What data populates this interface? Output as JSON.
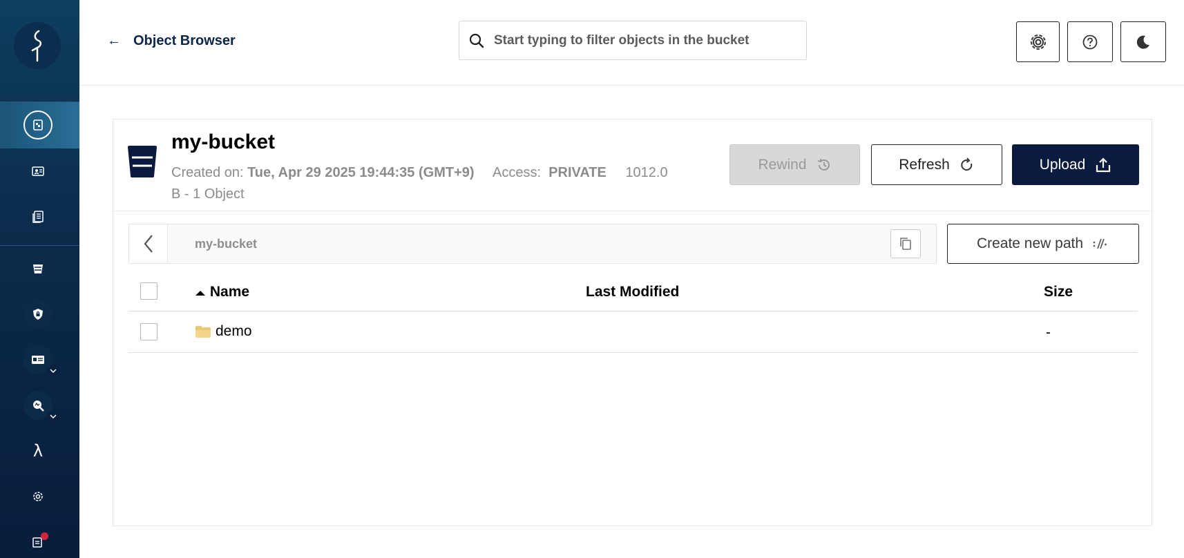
{
  "header": {
    "back_label": "Object Browser",
    "search_placeholder": "Start typing to filter objects in the bucket"
  },
  "bucket": {
    "name": "my-bucket",
    "created_label": "Created on:",
    "created_value": "Tue, Apr 29 2025 19:44:35 (GMT+9)",
    "access_label": "Access:",
    "access_value": "PRIVATE",
    "size_summary_1": "1012.0",
    "size_summary_2": "B - 1 Object"
  },
  "actions": {
    "rewind": "Rewind",
    "refresh": "Refresh",
    "upload": "Upload"
  },
  "path": {
    "current": "my-bucket",
    "create_new_path": "Create new path"
  },
  "table": {
    "columns": [
      "Name",
      "Last Modified",
      "Size"
    ],
    "rows": [
      {
        "name": "demo",
        "last_modified": "",
        "size": "-"
      }
    ]
  },
  "colors": {
    "sidebar_dark": "#091d3c",
    "brand_navy": "#0b1b3f",
    "notification": "#d1263b",
    "folder": "#e8c872"
  }
}
